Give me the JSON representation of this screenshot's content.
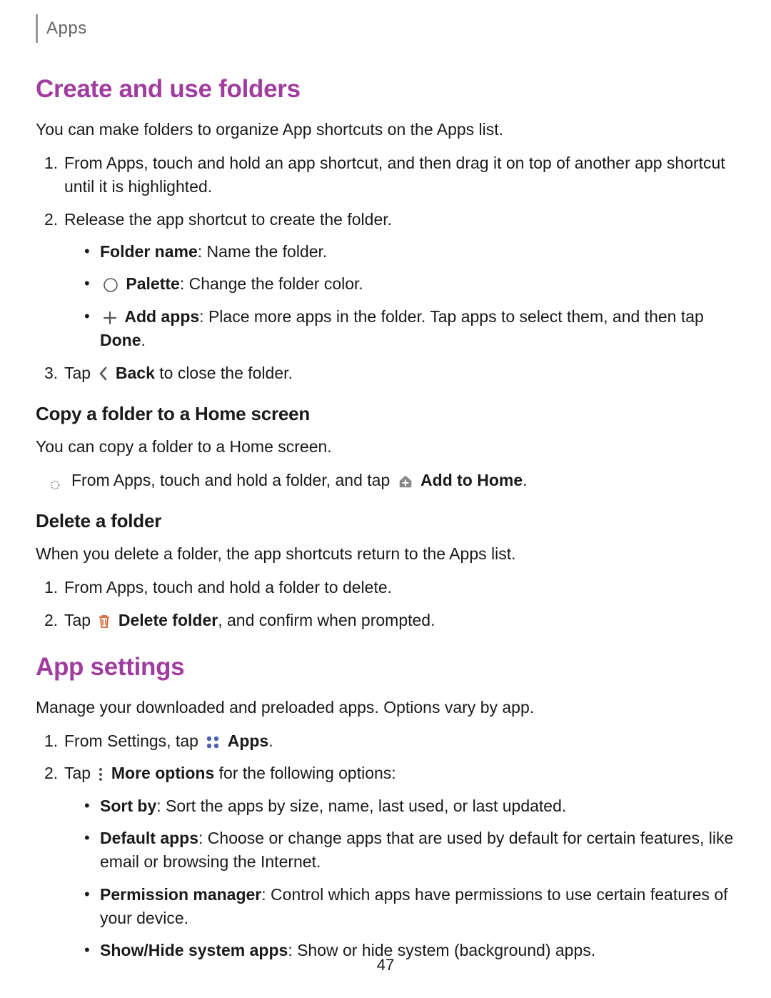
{
  "header": {
    "section": "Apps"
  },
  "s1": {
    "title": "Create and use folders",
    "intro": "You can make folders to organize App shortcuts on the Apps list.",
    "step1": "From Apps, touch and hold an app shortcut, and then drag it on top of another app shortcut until it is highlighted.",
    "step2": "Release the app shortcut to create the folder.",
    "b1_label": "Folder name",
    "b1_rest": ": Name the folder.",
    "b2_label": "Palette",
    "b2_rest": ": Change the folder color.",
    "b3_label": "Add apps",
    "b3_rest_a": ": Place more apps in the folder. Tap apps to select them, and then tap ",
    "b3_done": "Done",
    "b3_rest_b": ".",
    "step3_a": "Tap ",
    "step3_back": "Back",
    "step3_b": " to close the folder."
  },
  "s2": {
    "title": "Copy a folder to a Home screen",
    "intro": "You can copy a folder to a Home screen.",
    "bullet_a": "From Apps, touch and hold a folder, and tap ",
    "bullet_label": "Add to Home",
    "bullet_b": "."
  },
  "s3": {
    "title": "Delete a folder",
    "intro": "When you delete a folder, the app shortcuts return to the Apps list.",
    "step1": "From Apps, touch and hold a folder to delete.",
    "step2_a": "Tap ",
    "step2_label": "Delete folder",
    "step2_b": ", and confirm when prompted."
  },
  "s4": {
    "title": "App settings",
    "intro": "Manage your downloaded and preloaded apps. Options vary by app.",
    "step1_a": "From Settings, tap ",
    "step1_label": "Apps",
    "step1_b": ".",
    "step2_a": "Tap ",
    "step2_label": "More options",
    "step2_b": " for the following options:",
    "opt1_label": "Sort by",
    "opt1_rest": ": Sort the apps by size, name, last used, or last updated.",
    "opt2_label": "Default apps",
    "opt2_rest": ": Choose or change apps that are used by default for certain features, like email or browsing the Internet.",
    "opt3_label": "Permission manager",
    "opt3_rest": ": Control which apps have permissions to use certain features of your device.",
    "opt4_label": "Show/Hide system apps",
    "opt4_rest": ": Show or hide system (background) apps."
  },
  "page_number": "47"
}
